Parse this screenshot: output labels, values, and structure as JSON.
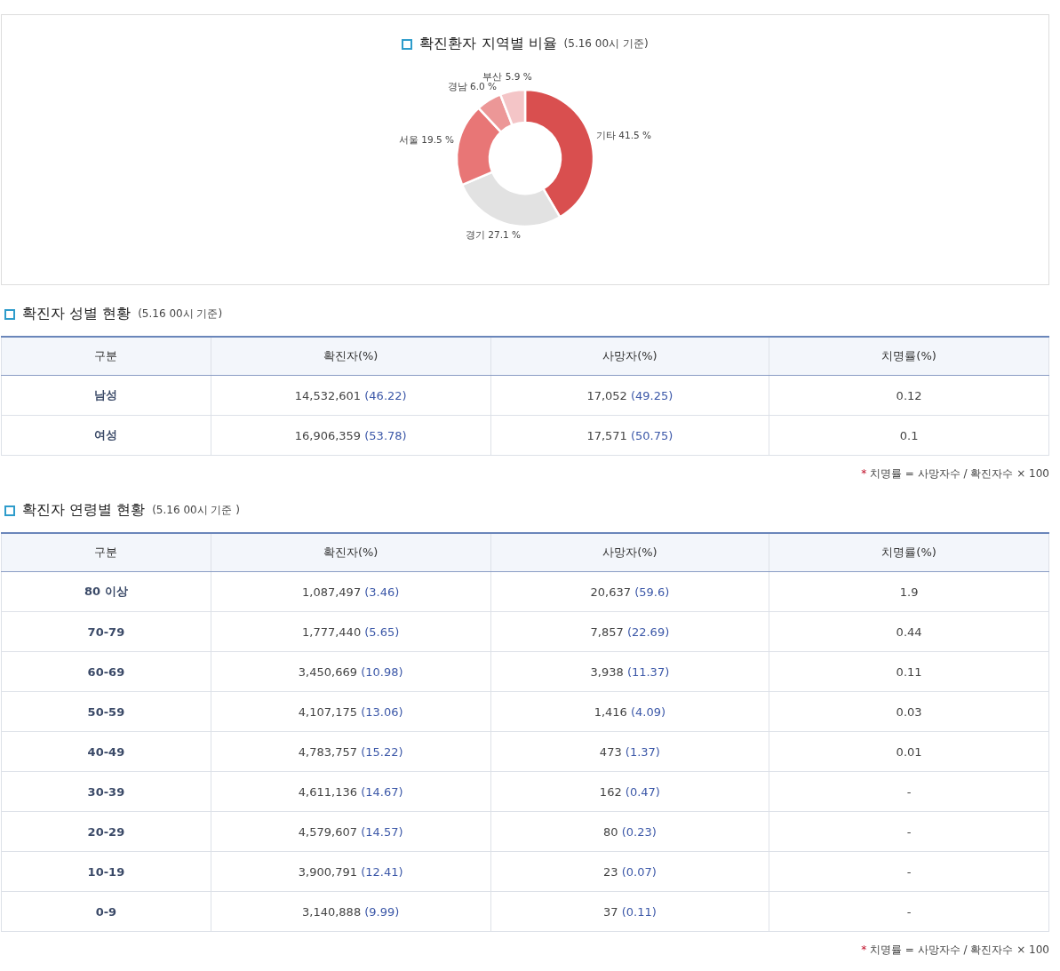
{
  "region_chart": {
    "title": "확진환자 지역별 비율",
    "note": "(5.16 00시 기준)",
    "chart_data": {
      "type": "donut",
      "categories": [
        "기타",
        "경기",
        "서울",
        "경남",
        "부산"
      ],
      "series": [
        {
          "values": [
            41.5,
            27.1,
            19.5,
            6.0,
            5.9
          ]
        }
      ],
      "colors": [
        "#d94f4f",
        "#e2e2e2",
        "#e87676",
        "#ec9797",
        "#f4c5c7"
      ],
      "value_labels": [
        "41.5 %",
        "27.1 %",
        "19.5 %",
        "6.0 %",
        "5.9 %"
      ]
    }
  },
  "sex_table": {
    "title": "확진자 성별 현황",
    "note": "(5.16 00시 기준)",
    "columns": [
      "구분",
      "확진자(%)",
      "사망자(%)",
      "치명률(%)"
    ],
    "rows": [
      {
        "group": "남성",
        "cases": {
          "count": "14,532,601",
          "pct": "(46.22)"
        },
        "deaths": {
          "count": "17,052",
          "pct": "(49.25)"
        },
        "fatality": "0.12"
      },
      {
        "group": "여성",
        "cases": {
          "count": "16,906,359",
          "pct": "(53.78)"
        },
        "deaths": {
          "count": "17,571",
          "pct": "(50.75)"
        },
        "fatality": "0.1"
      }
    ],
    "footnote": {
      "mark": "*",
      "text": "치명률 = 사망자수 / 확진자수 × 100"
    }
  },
  "age_table": {
    "title": "확진자 연령별 현황",
    "note": "(5.16 00시 기준 )",
    "columns": [
      "구분",
      "확진자(%)",
      "사망자(%)",
      "치명률(%)"
    ],
    "rows": [
      {
        "group": "80 이상",
        "cases": {
          "count": "1,087,497",
          "pct": "(3.46)"
        },
        "deaths": {
          "count": "20,637",
          "pct": "(59.6)"
        },
        "fatality": "1.9"
      },
      {
        "group": "70-79",
        "cases": {
          "count": "1,777,440",
          "pct": "(5.65)"
        },
        "deaths": {
          "count": "7,857",
          "pct": "(22.69)"
        },
        "fatality": "0.44"
      },
      {
        "group": "60-69",
        "cases": {
          "count": "3,450,669",
          "pct": "(10.98)"
        },
        "deaths": {
          "count": "3,938",
          "pct": "(11.37)"
        },
        "fatality": "0.11"
      },
      {
        "group": "50-59",
        "cases": {
          "count": "4,107,175",
          "pct": "(13.06)"
        },
        "deaths": {
          "count": "1,416",
          "pct": "(4.09)"
        },
        "fatality": "0.03"
      },
      {
        "group": "40-49",
        "cases": {
          "count": "4,783,757",
          "pct": "(15.22)"
        },
        "deaths": {
          "count": "473",
          "pct": "(1.37)"
        },
        "fatality": "0.01"
      },
      {
        "group": "30-39",
        "cases": {
          "count": "4,611,136",
          "pct": "(14.67)"
        },
        "deaths": {
          "count": "162",
          "pct": "(0.47)"
        },
        "fatality": "-"
      },
      {
        "group": "20-29",
        "cases": {
          "count": "4,579,607",
          "pct": "(14.57)"
        },
        "deaths": {
          "count": "80",
          "pct": "(0.23)"
        },
        "fatality": "-"
      },
      {
        "group": "10-19",
        "cases": {
          "count": "3,900,791",
          "pct": "(12.41)"
        },
        "deaths": {
          "count": "23",
          "pct": "(0.07)"
        },
        "fatality": "-"
      },
      {
        "group": "0-9",
        "cases": {
          "count": "3,140,888",
          "pct": "(9.99)"
        },
        "deaths": {
          "count": "37",
          "pct": "(0.11)"
        },
        "fatality": "-"
      }
    ],
    "footnote": {
      "mark": "*",
      "text": "치명률 = 사망자수 / 확진자수 × 100"
    }
  }
}
